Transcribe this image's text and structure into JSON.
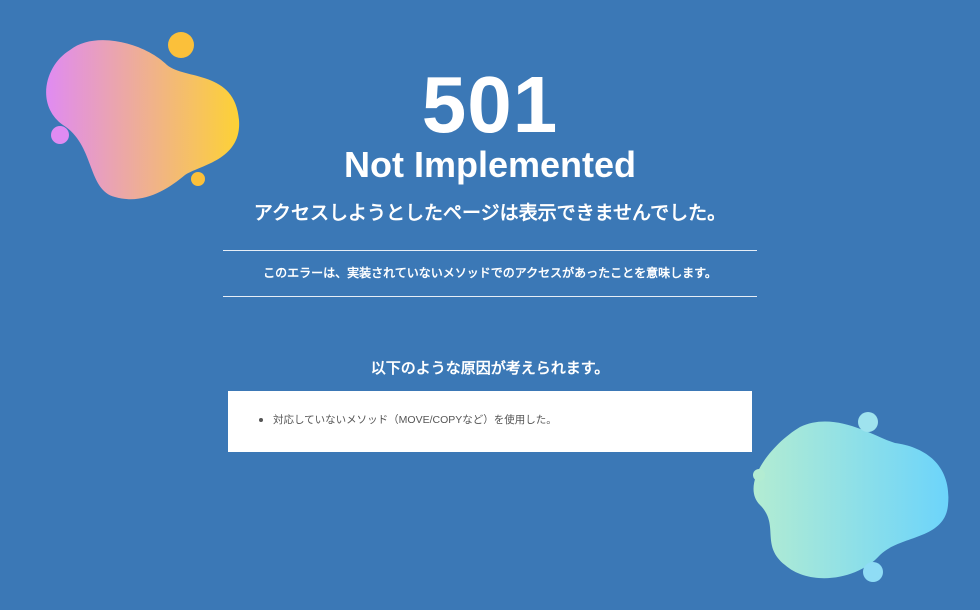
{
  "error": {
    "code": "501",
    "status": "Not Implemented",
    "lead": "アクセスしようとしたページは表示できませんでした。",
    "meaning": "このエラーは、実装されていないメソッドでのアクセスがあったことを意味します。"
  },
  "causes": {
    "heading": "以下のような原因が考えられます。",
    "items": [
      "対応していないメソッド（MOVE/COPYなど）を使用した。"
    ]
  },
  "colors": {
    "background": "#3b78b6",
    "text": "#ffffff",
    "top_blob_gradient": [
      "#e08bf2",
      "#fdd235"
    ],
    "bottom_blob_gradient": [
      "#b3ecd2",
      "#6cd4fb"
    ]
  }
}
